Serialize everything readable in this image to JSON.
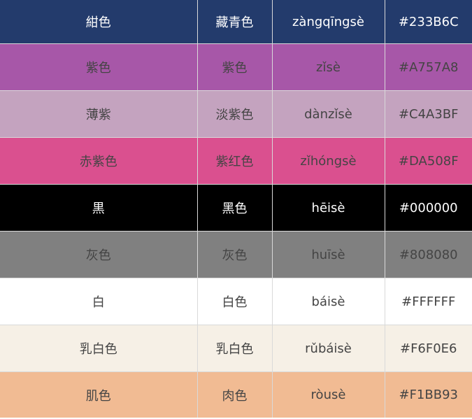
{
  "rows": [
    {
      "jp": "紺色",
      "cn": "藏青色",
      "pinyin": "zàngqīngsè",
      "hex": "#233B6C",
      "bg": "#233B6C",
      "text": "light"
    },
    {
      "jp": "紫色",
      "cn": "紫色",
      "pinyin": "zǐsè",
      "hex": "#A757A8",
      "bg": "#A757A8",
      "text": "dark"
    },
    {
      "jp": "薄紫",
      "cn": "淡紫色",
      "pinyin": "dànzǐsè",
      "hex": "#C4A3BF",
      "bg": "#C4A3BF",
      "text": "dark"
    },
    {
      "jp": "赤紫色",
      "cn": "紫红色",
      "pinyin": "zǐhóngsè",
      "hex": "#DA508F",
      "bg": "#DA508F",
      "text": "dark"
    },
    {
      "jp": "黒",
      "cn": "黑色",
      "pinyin": "hēisè",
      "hex": "#000000",
      "bg": "#000000",
      "text": "light"
    },
    {
      "jp": "灰色",
      "cn": "灰色",
      "pinyin": "huīsè",
      "hex": "#808080",
      "bg": "#808080",
      "text": "dark"
    },
    {
      "jp": "白",
      "cn": "白色",
      "pinyin": "báisè",
      "hex": "#FFFFFF",
      "bg": "#FFFFFF",
      "text": "dark"
    },
    {
      "jp": "乳白色",
      "cn": "乳白色",
      "pinyin": "rǔbáisè",
      "hex": "#F6F0E6",
      "bg": "#F6F0E6",
      "text": "dark"
    },
    {
      "jp": "肌色",
      "cn": "肉色",
      "pinyin": "ròusè",
      "hex": "#F1BB93",
      "bg": "#F1BB93",
      "text": "dark"
    }
  ]
}
